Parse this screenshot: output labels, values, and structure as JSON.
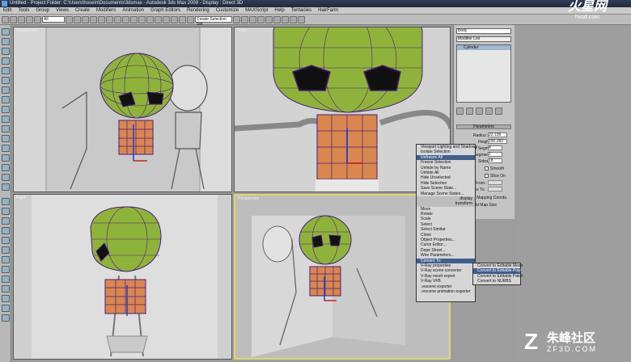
{
  "window": {
    "title": "Untitled - Project Folder: C:\\Users\\hosein\\Documents\\3dsmax - Autodesk 3ds Max 2009 - Display : Direct 3D"
  },
  "menubar": {
    "items": [
      "Edit",
      "Tools",
      "Group",
      "Views",
      "Create",
      "Modifiers",
      "Animation",
      "Graph Editors",
      "Rendering",
      "Customize",
      "MAXScript",
      "Help",
      "Tentacles",
      "HairFarm"
    ]
  },
  "toolbar": {
    "filter": "All",
    "selection_set": "Create Selection Set"
  },
  "viewports": {
    "top_left": "Perspective",
    "top_right": "Front",
    "bottom_left": "Right",
    "bottom_right": "Perspective"
  },
  "command_panel": {
    "object_name": "Body",
    "modifier_list": "Modifier List",
    "stack_item": "Cylinder",
    "rollout_title": "Parameters",
    "params": [
      {
        "label": "Radius:",
        "value": "22.136"
      },
      {
        "label": "Height:",
        "value": "150.283"
      },
      {
        "label": "Height Segments:",
        "value": "4"
      },
      {
        "label": "Cap Segments:",
        "value": "1"
      },
      {
        "label": "Sides:",
        "value": "18"
      }
    ],
    "smooth": "Smooth",
    "slice_on": "Slice On",
    "slice_from": "Slice From:",
    "slice_to": "Slice To:",
    "gen_mapping": "Generate Mapping Coords.",
    "real_world": "Real-World Map Size"
  },
  "quad_menu": {
    "display": [
      "Viewport Lighting and Shadows",
      "Isolate Selection",
      "Unfreeze All",
      "Freeze Selection",
      "Unhide by Name",
      "Unhide All",
      "Hide Unselected",
      "Hide Selection",
      "Save Scene State...",
      "Manage Scene States..."
    ],
    "display_label": "display",
    "transform_label": "transform",
    "transform": [
      "Move",
      "Rotate",
      "Scale",
      "Select",
      "Select Similar",
      "Clone",
      "Object Properties...",
      "Curve Editor...",
      "Dope Sheet...",
      "Wire Parameters...",
      "Convert To:",
      "V-Ray properties",
      "V-Ray scene converter",
      "V-Ray mesh export",
      "V-Ray VFB",
      ".vrscene exporter",
      ".vrscene animation exporter"
    ],
    "highlighted": "Convert To:"
  },
  "submenu": {
    "items": [
      "Convert to Editable Mesh",
      "Convert to Editable Poly",
      "Convert to Editable Patch",
      "Convert to NURBS"
    ],
    "highlighted": "Convert to Editable Poly"
  },
  "watermarks": {
    "top": "火星网",
    "top_url": "hxsd.com",
    "bottom": "朱峰社区",
    "bottom_url": "ZF3D.COM"
  },
  "colors": {
    "head": "#8fb33a",
    "body": "#d9874f",
    "wire": "#4a1d7a",
    "highlight": "#3f5f8f",
    "active_border": "#e3d36a"
  }
}
